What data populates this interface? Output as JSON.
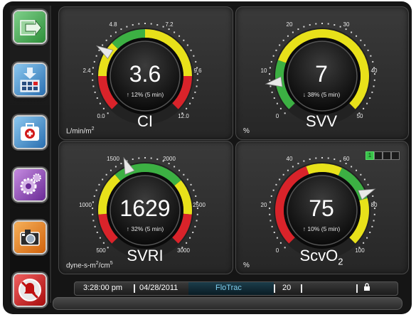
{
  "sidebar": {
    "buttons": [
      {
        "name": "move-forward-icon",
        "color": "#3aa142"
      },
      {
        "name": "data-download-icon",
        "color": "#2a86c8"
      },
      {
        "name": "clinical-tools-icon",
        "color": "#2a86c8"
      },
      {
        "name": "settings-gear-icon",
        "color": "#8b3cb8"
      },
      {
        "name": "snapshot-camera-icon",
        "color": "#e77a16"
      },
      {
        "name": "silence-alarm-icon",
        "color": "#d11a1a"
      }
    ]
  },
  "tiles": [
    {
      "id": "ci",
      "value": "3.6",
      "trend": "↑ 12% (5 min)",
      "param": "CI",
      "unit": "L/min/m",
      "unit_sup": "2",
      "ticks": [
        "0.0",
        "2.4",
        "4.8",
        "7.2",
        "9.6",
        "12.0"
      ]
    },
    {
      "id": "svv",
      "value": "7",
      "trend": "↓ 38% (5 min)",
      "param": "SVV",
      "unit": "%",
      "ticks": [
        "0",
        "10",
        "20",
        "30",
        "40",
        "50"
      ]
    },
    {
      "id": "svri",
      "value": "1629",
      "trend": "↑ 32% (5 min)",
      "param": "SVRI",
      "unit": "dyne-s-m",
      "unit_sup": "2",
      "unit_tail": "/cm",
      "unit_sup2": "5",
      "ticks": [
        "500",
        "1000",
        "1500",
        "2000",
        "2500",
        "3000"
      ]
    },
    {
      "id": "scvo2",
      "value": "75",
      "trend": "↑ 10% (5 min)",
      "param": "ScvO",
      "param_sub": "2",
      "unit": "%",
      "ticks": [
        "0",
        "20",
        "40",
        "60",
        "80",
        "100"
      ]
    }
  ],
  "status": {
    "time": "3:28:00 pm",
    "date": "04/28/2011",
    "mode": "FloTrac",
    "interval": "20",
    "lock_icon": "lock-icon"
  },
  "indicator": {
    "active": "1"
  },
  "colors": {
    "green": "#3cb043",
    "yellow": "#e8e11a",
    "red": "#d9232a",
    "mode_text": "#7fd0f0"
  }
}
